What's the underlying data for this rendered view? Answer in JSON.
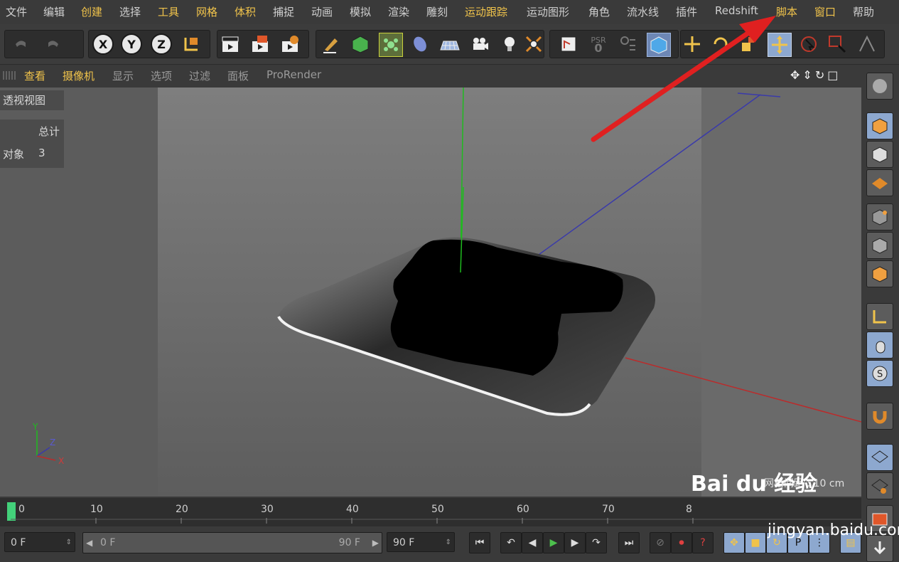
{
  "menu": [
    {
      "label": "文件",
      "highlight": false
    },
    {
      "label": "编辑",
      "highlight": false
    },
    {
      "label": "创建",
      "highlight": true
    },
    {
      "label": "选择",
      "highlight": false
    },
    {
      "label": "工具",
      "highlight": true
    },
    {
      "label": "网格",
      "highlight": true
    },
    {
      "label": "体积",
      "highlight": true
    },
    {
      "label": "捕捉",
      "highlight": false
    },
    {
      "label": "动画",
      "highlight": false
    },
    {
      "label": "模拟",
      "highlight": false
    },
    {
      "label": "渲染",
      "highlight": false
    },
    {
      "label": "雕刻",
      "highlight": false
    },
    {
      "label": "运动跟踪",
      "highlight": true
    },
    {
      "label": "运动图形",
      "highlight": false
    },
    {
      "label": "角色",
      "highlight": false
    },
    {
      "label": "流水线",
      "highlight": false
    },
    {
      "label": "插件",
      "highlight": false
    },
    {
      "label": "Redshift",
      "highlight": false
    },
    {
      "label": "脚本",
      "highlight": true
    },
    {
      "label": "窗口",
      "highlight": true
    },
    {
      "label": "帮助",
      "highlight": false
    }
  ],
  "axes_buttons": {
    "x": "X",
    "y": "Y",
    "z": "Z"
  },
  "toolbar_icons": [
    "undo-icon",
    "redo-icon",
    "render-view-icon",
    "render-active-icon",
    "render-settings-icon",
    "pen-icon",
    "cube-green-icon",
    "cloner-icon",
    "deformer-icon",
    "floor-icon",
    "camera-icon",
    "light-icon",
    "effector-icon",
    "scene-icon",
    "psr-icon",
    "locks-icon",
    "cube-view-icon",
    "move-icon",
    "rotate-icon",
    "scale-icon",
    "move-active-icon",
    "select-icon",
    "rect-select-icon",
    "misc-icon"
  ],
  "psr_label": "PSR",
  "psr_value": "0",
  "view_menu": [
    {
      "label": "查看",
      "highlight": true
    },
    {
      "label": "摄像机",
      "highlight": true
    },
    {
      "label": "显示",
      "highlight": false
    },
    {
      "label": "选项",
      "highlight": false
    },
    {
      "label": "过滤",
      "highlight": false
    },
    {
      "label": "面板",
      "highlight": false
    },
    {
      "label": "ProRender",
      "highlight": false
    }
  ],
  "viewport": {
    "title": "透视视图",
    "stats_header": "总计",
    "stats_label": "对象",
    "stats_value": "3",
    "grid_spacing": "网格间距 : 10 cm",
    "axis_y": "Y",
    "axis_z": "Z",
    "axis_x": "X"
  },
  "timeline": {
    "ticks": [
      "0",
      "10",
      "20",
      "30",
      "40",
      "50",
      "60",
      "70",
      "8"
    ],
    "current": "0 F",
    "range_start": "0 F",
    "range_end": "90 F",
    "end": "90 F"
  },
  "watermark": {
    "brand": "Bai du 经验",
    "url": "jingyan.baidu.com"
  },
  "colors": {
    "accent": "#f0c34b",
    "arrow": "#e02020",
    "active_blue": "#8da8cf",
    "play_green": "#4dc04d"
  }
}
